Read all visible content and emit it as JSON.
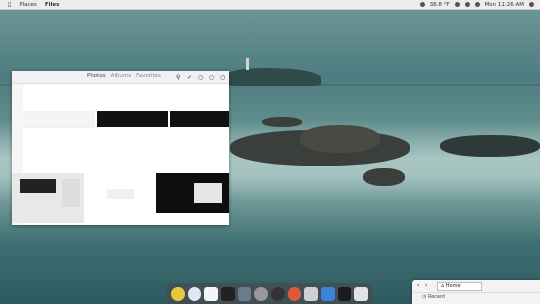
{
  "topbar": {
    "menu_places": "Places",
    "menu_files": "Files",
    "weather": "38.8 °F",
    "clock": "Mon 11:26 AM"
  },
  "photos": {
    "tabs": [
      "Photos",
      "Albums",
      "Favorites"
    ]
  },
  "file_manager": {
    "location": "Home",
    "sidebar_recent": "Recent"
  },
  "colors": {
    "accent": "#f1f1f1",
    "dock": "#464b50"
  },
  "dock_apps": [
    "chrome-icon",
    "safari-icon",
    "calendar-icon",
    "terminal-icon",
    "files-icon",
    "settings-icon",
    "steam-icon",
    "monitor-icon",
    "photos-icon",
    "app-icon",
    "terminal-icon",
    "camera-icon",
    "trash-icon"
  ]
}
